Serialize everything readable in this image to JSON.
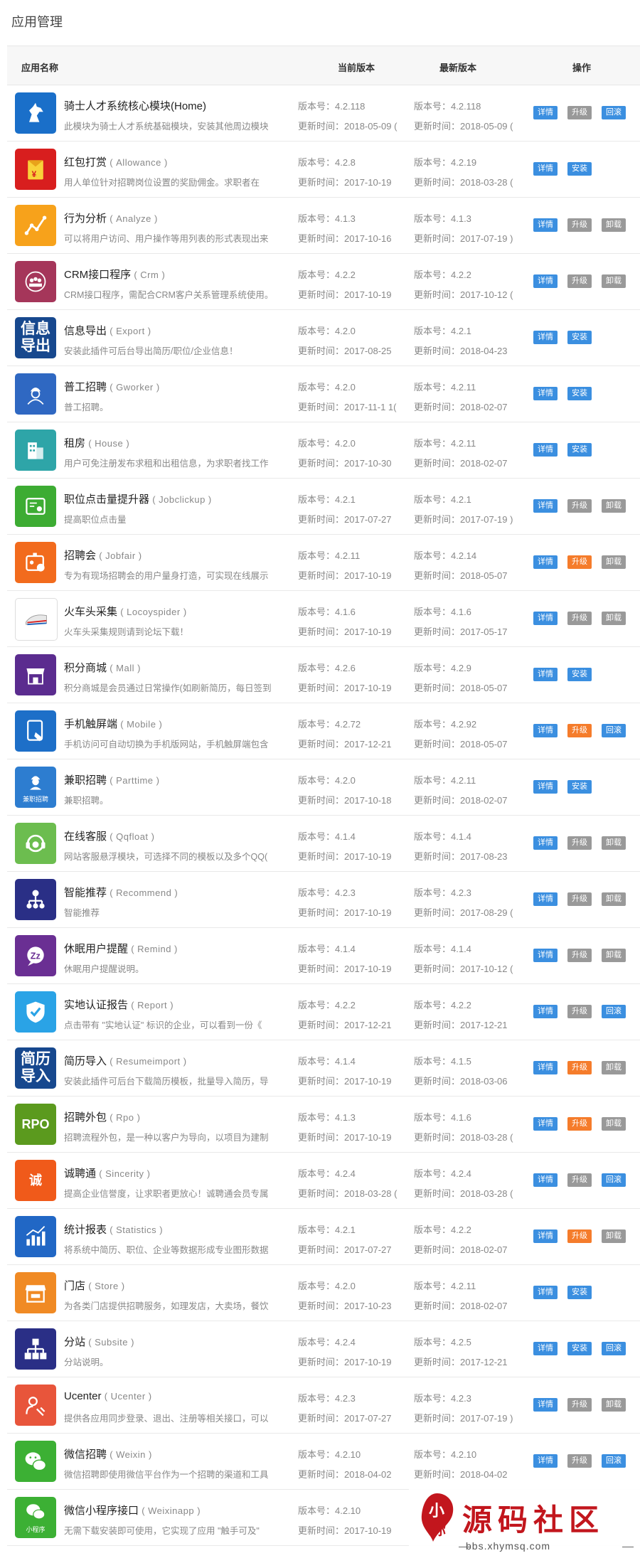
{
  "page": {
    "title": "应用管理"
  },
  "table": {
    "headers": {
      "name": "应用名称",
      "current": "当前版本",
      "latest": "最新版本",
      "actions": "操作"
    },
    "rows": [
      {
        "name": "骑士人才系统核心模块(Home)",
        "ename": "",
        "desc": "此模块为骑士人才系统基础模块，安装其他周边模块",
        "cur_ver": "版本号：4.2.118",
        "cur_time": "更新时间：2018-05-09 (",
        "lat_ver": "版本号：4.2.118",
        "lat_time": "更新时间：2018-05-09 (",
        "btn_mid": "升级",
        "btn_end": "回滚",
        "mid_color": "gray",
        "end_color": "blue",
        "icon": "knight-horse-icon",
        "icon_bg": "#1a6fc9"
      },
      {
        "name": "红包打赏",
        "ename": "( Allowance )",
        "desc": "用人单位针对招聘岗位设置的奖励佣金。求职者在",
        "cur_ver": "版本号：4.2.8",
        "cur_time": "更新时间：2017-10-19",
        "lat_ver": "版本号：4.2.19",
        "lat_time": "更新时间：2018-03-28 (",
        "btn_mid": "安装",
        "btn_end": "",
        "mid_color": "blue",
        "end_color": "",
        "icon": "red-envelope-icon",
        "icon_bg": "#d81e1e"
      },
      {
        "name": "行为分析",
        "ename": "( Analyze )",
        "desc": "可以将用户访问、用户操作等用列表的形式表现出来",
        "cur_ver": "版本号：4.1.3",
        "cur_time": "更新时间：2017-10-16",
        "lat_ver": "版本号：4.1.3",
        "lat_time": "更新时间：2017-07-19 )",
        "btn_mid": "升级",
        "btn_end": "卸载",
        "mid_color": "gray",
        "end_color": "gray",
        "icon": "line-graph-icon",
        "icon_bg": "#f7a21b"
      },
      {
        "name": "CRM接口程序",
        "ename": "( Crm )",
        "desc": "CRM接口程序，需配合CRM客户关系管理系统使用。",
        "cur_ver": "版本号：4.2.2",
        "cur_time": "更新时间：2017-10-19",
        "lat_ver": "版本号：4.2.2",
        "lat_time": "更新时间：2017-10-12 (",
        "btn_mid": "升级",
        "btn_end": "卸载",
        "mid_color": "gray",
        "end_color": "gray",
        "icon": "crm-people-icon",
        "icon_bg": "#a5365a"
      },
      {
        "name": "信息导出",
        "ename": "( Export )",
        "desc": "安装此插件可后台导出简历/职位/企业信息！",
        "cur_ver": "版本号：4.2.0",
        "cur_time": "更新时间：2017-08-25",
        "lat_ver": "版本号：4.2.1",
        "lat_time": "更新时间：2018-04-23",
        "btn_mid": "安装",
        "btn_end": "",
        "mid_color": "blue",
        "end_color": "",
        "icon": "export-text-icon",
        "icon_bg": "#17488e",
        "icon_text": "信息\n导出"
      },
      {
        "name": "普工招聘",
        "ename": "( Gworker )",
        "desc": "普工招聘。",
        "cur_ver": "版本号：4.2.0",
        "cur_time": "更新时间：2017-11-1 1(",
        "lat_ver": "版本号：4.2.11",
        "lat_time": "更新时间：2018-02-07",
        "btn_mid": "安装",
        "btn_end": "",
        "mid_color": "blue",
        "end_color": "",
        "icon": "worker-icon",
        "icon_bg": "#2f68c2"
      },
      {
        "name": "租房",
        "ename": "( House )",
        "desc": "用户可免注册发布求租和出租信息，为求职者找工作",
        "cur_ver": "版本号：4.2.0",
        "cur_time": "更新时间：2017-10-30",
        "lat_ver": "版本号：4.2.11",
        "lat_time": "更新时间：2018-02-07",
        "btn_mid": "安装",
        "btn_end": "",
        "mid_color": "blue",
        "end_color": "",
        "icon": "building-icon",
        "icon_bg": "#2ea5a8"
      },
      {
        "name": "职位点击量提升器",
        "ename": "( Jobclickup )",
        "desc": "提高职位点击量",
        "cur_ver": "版本号：4.2.1",
        "cur_time": "更新时间：2017-07-27",
        "lat_ver": "版本号：4.2.1",
        "lat_time": "更新时间：2017-07-19 )",
        "btn_mid": "升级",
        "btn_end": "卸载",
        "mid_color": "gray",
        "end_color": "gray",
        "icon": "eye-card-icon",
        "icon_bg": "#3dac33"
      },
      {
        "name": "招聘会",
        "ename": "( Jobfair )",
        "desc": "专为有现场招聘会的用户量身打造，可实现在线展示",
        "cur_ver": "版本号：4.2.11",
        "cur_time": "更新时间：2017-10-19",
        "lat_ver": "版本号：4.2.14",
        "lat_time": "更新时间：2018-05-07",
        "btn_mid": "升级",
        "btn_end": "卸载",
        "mid_color": "orange",
        "end_color": "gray",
        "icon": "badge-icon",
        "icon_bg": "#f26b1d"
      },
      {
        "name": "火车头采集",
        "ename": "( Locoyspider )",
        "desc": "火车头采集规则请到论坛下载！",
        "cur_ver": "版本号：4.1.6",
        "cur_time": "更新时间：2017-10-19",
        "lat_ver": "版本号：4.1.6",
        "lat_time": "更新时间：2017-05-17",
        "btn_mid": "升级",
        "btn_end": "卸载",
        "mid_color": "gray",
        "end_color": "gray",
        "icon": "train-icon",
        "icon_bg": "#ffffff"
      },
      {
        "name": "积分商城",
        "ename": "( Mall )",
        "desc": "积分商城是会员通过日常操作(如刷新简历，每日签到",
        "cur_ver": "版本号：4.2.6",
        "cur_time": "更新时间：2017-10-19",
        "lat_ver": "版本号：4.2.9",
        "lat_time": "更新时间：2018-05-07",
        "btn_mid": "安装",
        "btn_end": "",
        "mid_color": "blue",
        "end_color": "",
        "icon": "shop-icon",
        "icon_bg": "#5b2c8f"
      },
      {
        "name": "手机触屏端",
        "ename": "( Mobile )",
        "desc": "手机访问可自动切换为手机版网站，手机触屏端包含",
        "cur_ver": "版本号：4.2.72",
        "cur_time": "更新时间：2017-12-21",
        "lat_ver": "版本号：4.2.92",
        "lat_time": "更新时间：2018-05-07",
        "btn_mid": "升级",
        "btn_end": "回滚",
        "mid_color": "orange",
        "end_color": "blue",
        "icon": "tablet-hand-icon",
        "icon_bg": "#1d6fc8"
      },
      {
        "name": "兼职招聘",
        "ename": "( Parttime )",
        "desc": "兼职招聘。",
        "cur_ver": "版本号：4.2.0",
        "cur_time": "更新时间：2017-10-18",
        "lat_ver": "版本号：4.2.11",
        "lat_time": "更新时间：2018-02-07",
        "btn_mid": "安装",
        "btn_end": "",
        "mid_color": "blue",
        "end_color": "",
        "icon": "parttime-worker-icon",
        "icon_bg": "#2d7dd0",
        "icon_caption": "兼职招聘"
      },
      {
        "name": "在线客服",
        "ename": "( Qqfloat )",
        "desc": "网站客服悬浮模块，可选择不同的模板以及多个QQ(",
        "cur_ver": "版本号：4.1.4",
        "cur_time": "更新时间：2017-10-19",
        "lat_ver": "版本号：4.1.4",
        "lat_time": "更新时间：2017-08-23",
        "btn_mid": "升级",
        "btn_end": "卸载",
        "mid_color": "gray",
        "end_color": "gray",
        "icon": "headset-icon",
        "icon_bg": "#6cbd4f"
      },
      {
        "name": "智能推荐",
        "ename": "( Recommend )",
        "desc": "智能推荐",
        "cur_ver": "版本号：4.2.3",
        "cur_time": "更新时间：2017-10-19",
        "lat_ver": "版本号：4.2.3",
        "lat_time": "更新时间：2017-08-29 (",
        "btn_mid": "升级",
        "btn_end": "卸载",
        "mid_color": "gray",
        "end_color": "gray",
        "icon": "hierarchy-icon",
        "icon_bg": "#2a2f86"
      },
      {
        "name": "休眠用户提醒",
        "ename": "( Remind )",
        "desc": "休眠用户提醒说明。",
        "cur_ver": "版本号：4.1.4",
        "cur_time": "更新时间：2017-10-19",
        "lat_ver": "版本号：4.1.4",
        "lat_time": "更新时间：2017-10-12 (",
        "btn_mid": "升级",
        "btn_end": "卸载",
        "mid_color": "gray",
        "end_color": "gray",
        "icon": "sleep-bubble-icon",
        "icon_bg": "#6a2f93"
      },
      {
        "name": "实地认证报告",
        "ename": "( Report )",
        "desc": "点击带有 \"实地认证\" 标识的企业，可以看到一份《",
        "cur_ver": "版本号：4.2.2",
        "cur_time": "更新时间：2017-12-21",
        "lat_ver": "版本号：4.2.2",
        "lat_time": "更新时间：2017-12-21",
        "btn_mid": "升级",
        "btn_end": "回滚",
        "mid_color": "gray",
        "end_color": "blue",
        "icon": "shield-check-icon",
        "icon_bg": "#2aa3e6"
      },
      {
        "name": "简历导入",
        "ename": "( Resumeimport )",
        "desc": "安装此插件可后台下载简历模板，批量导入简历，导",
        "cur_ver": "版本号：4.1.4",
        "cur_time": "更新时间：2017-10-19",
        "lat_ver": "版本号：4.1.5",
        "lat_time": "更新时间：2018-03-06",
        "btn_mid": "升级",
        "btn_end": "卸载",
        "mid_color": "orange",
        "end_color": "gray",
        "icon": "resume-import-text-icon",
        "icon_bg": "#17488e",
        "icon_text": "简历\n导入"
      },
      {
        "name": "招聘外包",
        "ename": "( Rpo )",
        "desc": "招聘流程外包，是一种以客户为导向，以项目为建制",
        "cur_ver": "版本号：4.1.3",
        "cur_time": "更新时间：2017-10-19",
        "lat_ver": "版本号：4.1.6",
        "lat_time": "更新时间：2018-03-28 (",
        "btn_mid": "升级",
        "btn_end": "卸载",
        "mid_color": "orange",
        "end_color": "gray",
        "icon": "rpo-text-icon",
        "icon_bg": "#5b9a1e",
        "icon_text": "RPO"
      },
      {
        "name": "诚聘通",
        "ename": "( Sincerity )",
        "desc": "提高企业信誉度，让求职者更放心！诚聘通会员专属",
        "cur_ver": "版本号：4.2.4",
        "cur_time": "更新时间：2018-03-28 (",
        "lat_ver": "版本号：4.2.4",
        "lat_time": "更新时间：2018-03-28 (",
        "btn_mid": "升级",
        "btn_end": "回滚",
        "mid_color": "gray",
        "end_color": "blue",
        "icon": "sincerity-seal-icon",
        "icon_bg": "#f05a1a",
        "icon_text": "诚"
      },
      {
        "name": "统计报表",
        "ename": "( Statistics )",
        "desc": "将系统中简历、职位、企业等数据形成专业图形数据",
        "cur_ver": "版本号：4.2.1",
        "cur_time": "更新时间：2017-07-27",
        "lat_ver": "版本号：4.2.2",
        "lat_time": "更新时间：2018-02-07",
        "btn_mid": "升级",
        "btn_end": "卸载",
        "mid_color": "orange",
        "end_color": "gray",
        "icon": "bar-chart-icon",
        "icon_bg": "#2167c5"
      },
      {
        "name": "门店",
        "ename": "( Store )",
        "desc": "为各类门店提供招聘服务，如理发店，大卖场，餐饮",
        "cur_ver": "版本号：4.2.0",
        "cur_time": "更新时间：2017-10-23",
        "lat_ver": "版本号：4.2.11",
        "lat_time": "更新时间：2018-02-07",
        "btn_mid": "安装",
        "btn_end": "",
        "mid_color": "blue",
        "end_color": "",
        "icon": "storefront-icon",
        "icon_bg": "#f08a24"
      },
      {
        "name": "分站",
        "ename": "( Subsite )",
        "desc": "分站说明。",
        "cur_ver": "版本号：4.2.4",
        "cur_time": "更新时间：2017-10-19",
        "lat_ver": "版本号：4.2.5",
        "lat_time": "更新时间：2017-12-21",
        "btn_mid": "安装",
        "btn_end": "回滚",
        "mid_color": "blue",
        "end_color": "blue",
        "icon": "network-icon",
        "icon_bg": "#2a2f86"
      },
      {
        "name": "Ucenter",
        "ename": "( Ucenter )",
        "desc": "提供各应用同步登录、退出、注册等相关接口，可以",
        "cur_ver": "版本号：4.2.3",
        "cur_time": "更新时间：2017-07-27",
        "lat_ver": "版本号：4.2.3",
        "lat_time": "更新时间：2017-07-19 )",
        "btn_mid": "升级",
        "btn_end": "卸载",
        "mid_color": "gray",
        "end_color": "gray",
        "icon": "user-link-icon",
        "icon_bg": "#e8553b"
      },
      {
        "name": "微信招聘",
        "ename": "( Weixin )",
        "desc": "微信招聘即使用微信平台作为一个招聘的渠道和工具",
        "cur_ver": "版本号：4.2.10",
        "cur_time": "更新时间：2018-04-02",
        "lat_ver": "版本号：4.2.10",
        "lat_time": "更新时间：2018-04-02",
        "btn_mid": "升级",
        "btn_end": "回滚",
        "mid_color": "gray",
        "end_color": "blue",
        "icon": "wechat-icon",
        "icon_bg": "#3cb034"
      },
      {
        "name": "微信小程序接口",
        "ename": "( Weixinapp )",
        "desc": "无需下载安装即可使用，它实现了应用 \"触手可及\"",
        "cur_ver": "版本号：4.2.10",
        "cur_time": "更新时间：2017-10-19",
        "lat_ver": "",
        "lat_time": "",
        "btn_mid": "",
        "btn_end": "",
        "mid_color": "",
        "end_color": "",
        "icon": "wechat-mini-program-icon",
        "icon_bg": "#3cb034",
        "icon_caption": "小程序",
        "hide_detail": true
      }
    ],
    "detail_label": "详情"
  },
  "watermark": {
    "logo_text": "小\n你",
    "title": "源码社区",
    "url": "bbs.xhymsq.com"
  }
}
